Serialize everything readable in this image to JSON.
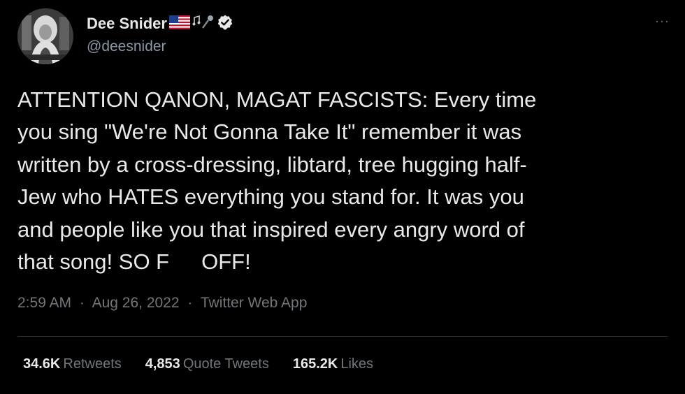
{
  "author": {
    "display_name": "Dee Snider",
    "handle": "@deesnider",
    "flag_icon": "us-flag-icon",
    "emoji_icon": "music-note-microphone-icon",
    "verified_icon": "verified-badge-icon"
  },
  "tweet": {
    "lines": [
      "ATTENTION QANON, MAGAT FASCISTS: Every time",
      "you sing \"We're Not Gonna Take It\" remember it was",
      "written by a cross-dressing, libtard, tree hugging half-",
      "Jew who HATES everything you stand for. It was you",
      "and people like you that inspired every angry word of"
    ],
    "last_line_start": "that song! SO F",
    "last_line_end": "OFF!"
  },
  "meta": {
    "time": "2:59 AM",
    "separator": "·",
    "date": "Aug 26, 2022",
    "source": "Twitter Web App"
  },
  "stats": {
    "retweets_count": "34.6K",
    "retweets_label": "Retweets",
    "quote_count": "4,853",
    "quote_label": "Quote Tweets",
    "likes_count": "165.2K",
    "likes_label": "Likes"
  },
  "more_label": "···"
}
